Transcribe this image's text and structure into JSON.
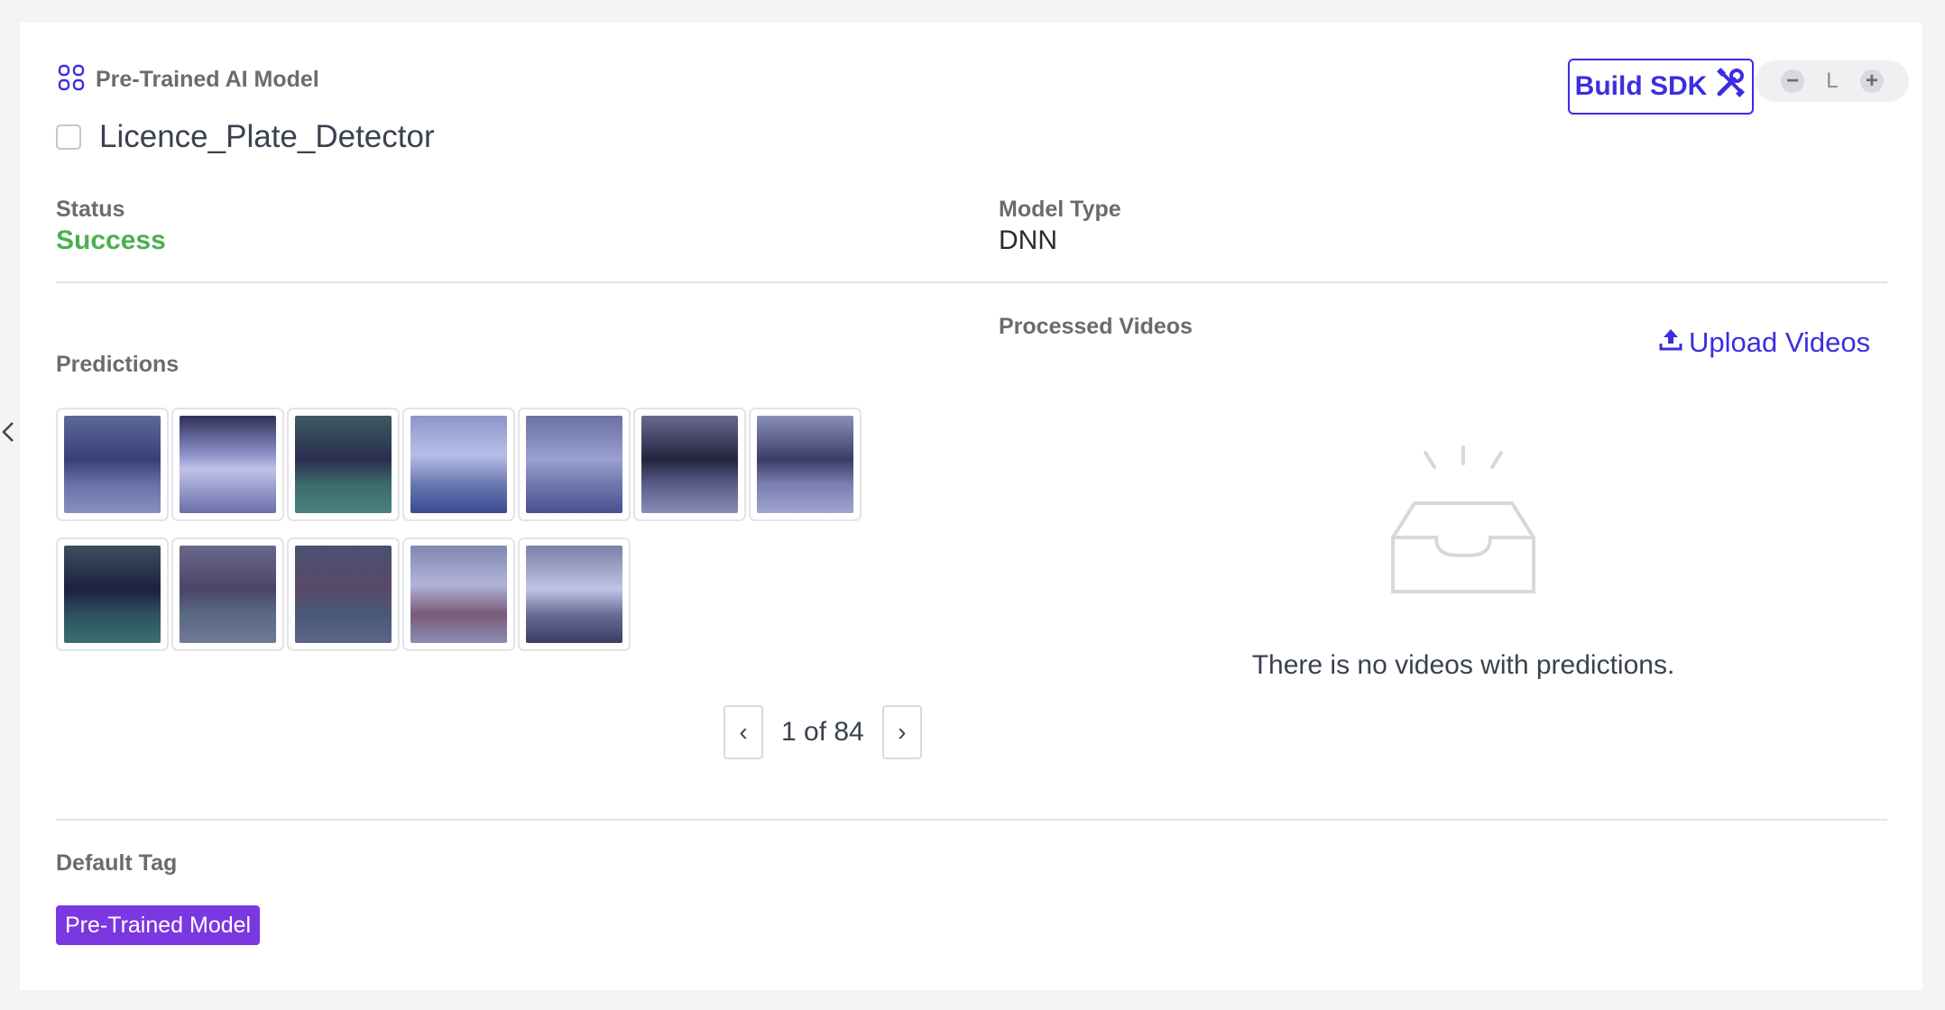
{
  "header": {
    "section_label": "Pre-Trained AI Model",
    "model_name": "Licence_Plate_Detector",
    "build_button_label": "Build SDK",
    "zoom_level": "L"
  },
  "fields": {
    "status_label": "Status",
    "status_value": "Success",
    "model_type_label": "Model Type",
    "model_type_value": "DNN"
  },
  "predictions": {
    "label": "Predictions",
    "thumbnail_count": 12,
    "pagination": {
      "text": "1 of 84",
      "prev": "‹",
      "next": "›"
    }
  },
  "videos": {
    "label": "Processed Videos",
    "upload_label": "Upload Videos",
    "empty_message": "There is no videos with predictions."
  },
  "tags": {
    "label": "Default Tag",
    "items": [
      "Pre-Trained Model"
    ]
  },
  "colors": {
    "accent": "#3b2ee0",
    "success": "#4caf50",
    "tag": "#7b37e0"
  }
}
